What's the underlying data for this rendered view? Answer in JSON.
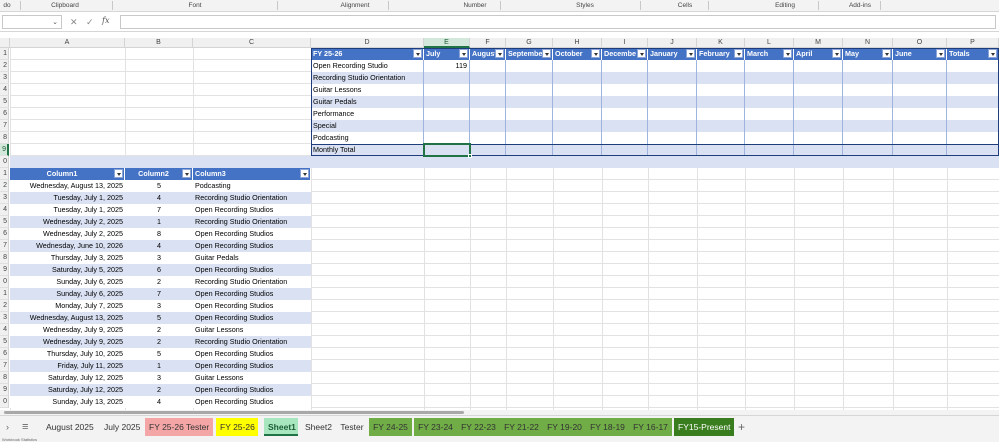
{
  "ribbon": {
    "groups": [
      "do",
      "Clipboard",
      "Font",
      "Alignment",
      "Number",
      "Styles",
      "Cells",
      "Editing",
      "Add-ins"
    ]
  },
  "formula_bar": {
    "name_box": "",
    "fx": "fx",
    "formula": ""
  },
  "columns": [
    "A",
    "B",
    "C",
    "D",
    "E",
    "F",
    "G",
    "H",
    "I",
    "J",
    "K",
    "L",
    "M",
    "N",
    "O",
    "P"
  ],
  "rows": [
    "1",
    "2",
    "3",
    "4",
    "5",
    "6",
    "7",
    "8",
    "9",
    "0",
    "1",
    "2",
    "3",
    "4",
    "5",
    "6",
    "7",
    "8",
    "9",
    "0",
    "1",
    "2",
    "3",
    "4",
    "5",
    "6",
    "7",
    "8",
    "9",
    "0"
  ],
  "fy_table": {
    "headers": [
      "FY 25-26",
      "July",
      "August",
      "Septembe",
      "October",
      "Decembe",
      "January",
      "February",
      "March",
      "April",
      "May",
      "June",
      "Totals"
    ],
    "rows": [
      {
        "label": "Open Recording Studio",
        "july": "119"
      },
      {
        "label": "Recording Studio Orientation",
        "july": ""
      },
      {
        "label": "Guitar Lessons",
        "july": ""
      },
      {
        "label": "Guitar Pedals",
        "july": ""
      },
      {
        "label": "Performance",
        "july": ""
      },
      {
        "label": "Special",
        "july": ""
      },
      {
        "label": "Podcasting",
        "july": ""
      },
      {
        "label": "Monthly Total",
        "july": ""
      }
    ]
  },
  "log_table": {
    "headers": [
      "Column1",
      "Column2",
      "Column3"
    ],
    "rows": [
      [
        "Wednesday, August 13, 2025",
        "5",
        "Podcasting"
      ],
      [
        "Tuesday, July 1, 2025",
        "4",
        "Recording Studio Orientation"
      ],
      [
        "Tuesday, July 1, 2025",
        "7",
        "Open Recording Studios"
      ],
      [
        "Wednesday, July 2, 2025",
        "1",
        "Recording Studio Orientation"
      ],
      [
        "Wednesday, July 2, 2025",
        "8",
        "Open Recording Studios"
      ],
      [
        "Wednesday, June 10, 2026",
        "4",
        "Open Recording Studios"
      ],
      [
        "Thursday, July 3, 2025",
        "3",
        "Guitar Pedals"
      ],
      [
        "Saturday, July 5, 2025",
        "6",
        "Open Recording Studios"
      ],
      [
        "Sunday, July 6, 2025",
        "2",
        "Recording Studio Orientation"
      ],
      [
        "Sunday, July 6, 2025",
        "7",
        "Open Recording Studios"
      ],
      [
        "Monday, July 7, 2025",
        "3",
        "Open Recording Studios"
      ],
      [
        "Wednesday, August 13, 2025",
        "5",
        "Open Recording Studios"
      ],
      [
        "Wednesday, July 9, 2025",
        "2",
        "Guitar Lessons"
      ],
      [
        "Wednesday, July 9, 2025",
        "2",
        "Recording Studio Orientation"
      ],
      [
        "Thursday, July 10, 2025",
        "5",
        "Open Recording Studios"
      ],
      [
        "Friday, July 11, 2025",
        "1",
        "Open Recording Studios"
      ],
      [
        "Saturday, July 12, 2025",
        "3",
        "Guitar Lessons"
      ],
      [
        "Saturday, July 12, 2025",
        "2",
        "Open Recording Studios"
      ],
      [
        "Sunday, July 13, 2025",
        "4",
        "Open Recording Studios"
      ]
    ]
  },
  "sheet_tabs": [
    {
      "label": "August 2025",
      "color": ""
    },
    {
      "label": "July 2025",
      "color": ""
    },
    {
      "label": "FY 25-26  Tester",
      "color": "#f4a6a6"
    },
    {
      "label": "FY 25-26",
      "color": "#ffff00"
    },
    {
      "label": "Sheet1",
      "color": "#a8e6c0",
      "active": true
    },
    {
      "label": "Sheet2",
      "color": ""
    },
    {
      "label": "Tester",
      "color": ""
    },
    {
      "label": "FY 24-25",
      "color": "#70ad47"
    },
    {
      "label": "FY 23-24",
      "color": "#70ad47"
    },
    {
      "label": "FY 22-23",
      "color": "#70ad47"
    },
    {
      "label": "FY 21-22",
      "color": "#70ad47"
    },
    {
      "label": "FY 19-20",
      "color": "#70ad47"
    },
    {
      "label": "FY 18-19",
      "color": "#70ad47"
    },
    {
      "label": "FY 16-17",
      "color": "#70ad47"
    },
    {
      "label": "FY15-Present",
      "color": "#3a7d1e"
    }
  ],
  "status": {
    "text": "Workbook Statistics"
  },
  "colors": {
    "accent": "#217346",
    "table_header": "#4472c4",
    "table_band": "#d9e1f2"
  }
}
